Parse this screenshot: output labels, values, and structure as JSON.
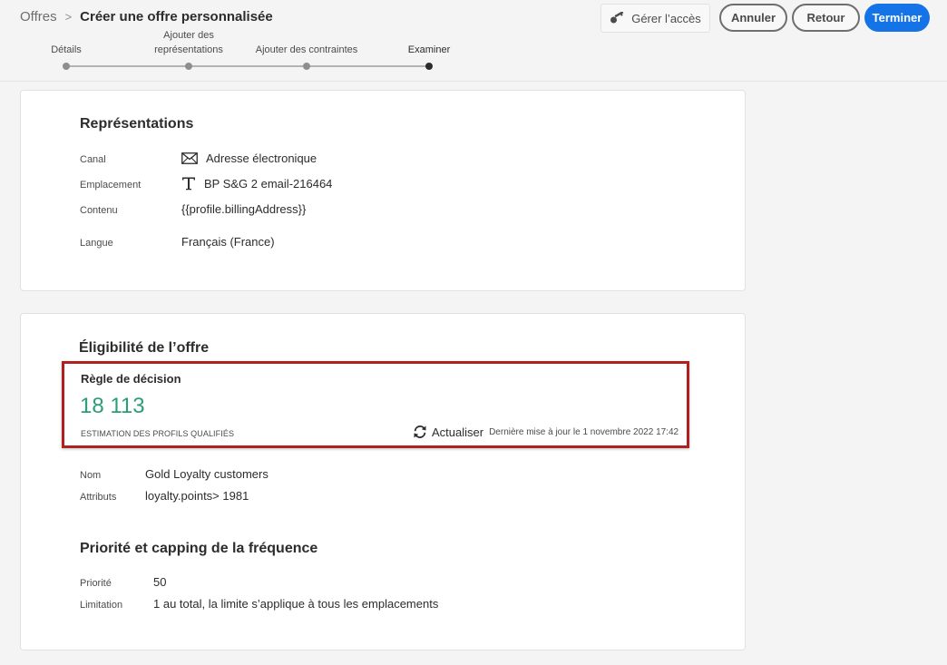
{
  "header": {
    "breadcrumb_root": "Offres",
    "breadcrumb_separator": ">",
    "title": "Créer une offre personnalisée",
    "buttons": {
      "access": "Gérer l’accès",
      "cancel": "Annuler",
      "back": "Retour",
      "finish": "Terminer"
    }
  },
  "stepper": {
    "steps": [
      {
        "label": "Détails"
      },
      {
        "label_line1": "Ajouter des",
        "label_line2": "représentations"
      },
      {
        "label": "Ajouter des contraintes"
      },
      {
        "label": "Examiner"
      }
    ],
    "active_step": "Examiner"
  },
  "representations": {
    "title": "Représentations",
    "rows": [
      {
        "label": "Canal",
        "value": "Adresse électronique",
        "icon": "envelope-icon"
      },
      {
        "label": "Emplacement",
        "value": "BP S&G 2 email-216464",
        "icon": "text-icon"
      },
      {
        "label": "Contenu",
        "value": "{{profile.billingAddress}}"
      },
      {
        "label": "Langue",
        "value": "Français (France)"
      }
    ]
  },
  "eligibility": {
    "title": "Éligibilité de l’offre",
    "rule": {
      "title": "Règle de décision",
      "count": "18 113",
      "caption": "ESTIMATION DES PROFILS QUALIFIÉS",
      "refresh_label": "Actualiser",
      "last_update": "Dernière mise à jour le 1 novembre 2022 17:42",
      "refresh_icon": "refresh-icon"
    },
    "rows": [
      {
        "label": "Nom",
        "value": "Gold Loyalty customers"
      },
      {
        "label": "Attributs",
        "value": "loyalty.points> 1981"
      }
    ]
  },
  "priority": {
    "title": "Priorité et capping de la fréquence",
    "rows": [
      {
        "label": "Priorité",
        "value": "50"
      },
      {
        "label": "Limitation",
        "value": "1 au total, la limite s’applique à tous les emplacements"
      }
    ]
  },
  "colors": {
    "accent": "#1473e6",
    "count_green": "#2d9d78",
    "highlight_red": "#b0201f"
  }
}
